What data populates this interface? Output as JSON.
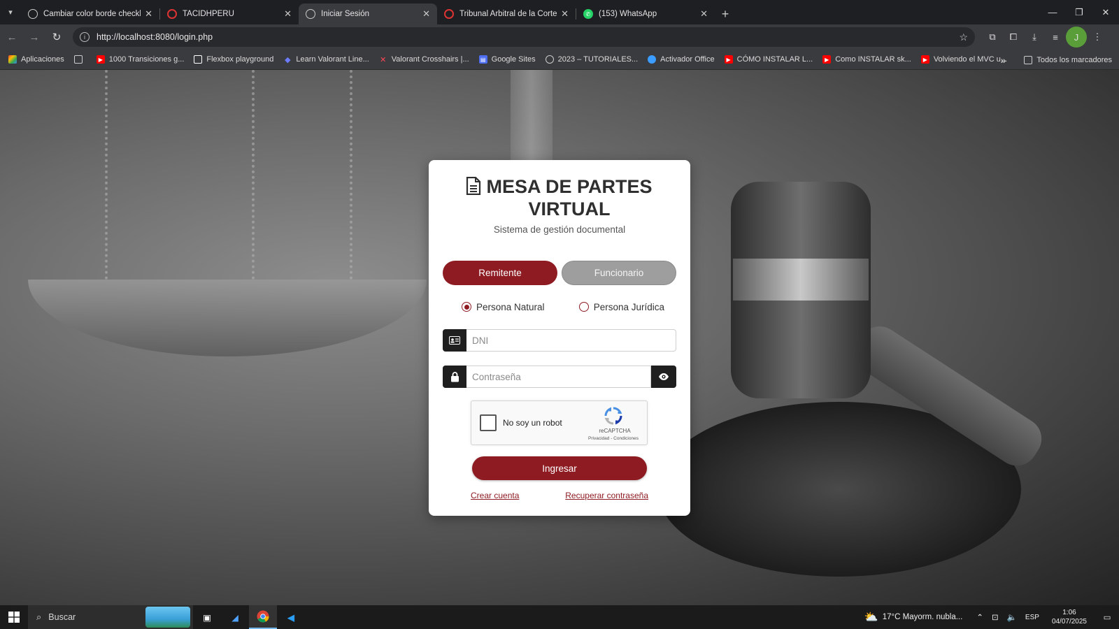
{
  "browser": {
    "tabs": [
      {
        "title": "Cambiar color borde checkbox",
        "favicon": "globe-icon",
        "active": false
      },
      {
        "title": "TACIDHPERU",
        "favicon": "red-circle-icon",
        "active": false
      },
      {
        "title": "Iniciar Sesión",
        "favicon": "globe-icon",
        "active": true
      },
      {
        "title": "Tribunal Arbitral de la Corte Inte",
        "favicon": "red-circle-icon",
        "active": false
      },
      {
        "title": "(153) WhatsApp",
        "favicon": "whatsapp-icon",
        "active": false
      }
    ],
    "url": "http://localhost:8080/login.php",
    "bookmarks": [
      {
        "label": "Aplicaciones",
        "icon": "apps-grid-icon",
        "color": "#e8a33d"
      },
      {
        "label": "",
        "icon": "grid-icon",
        "color": "#cccccc"
      },
      {
        "label": "1000 Transiciones g...",
        "icon": "youtube-icon",
        "color": "#ff0000"
      },
      {
        "label": "Flexbox playground",
        "icon": "flexbox-icon",
        "color": "#ffffff"
      },
      {
        "label": "Learn Valorant Line...",
        "icon": "diamond-icon",
        "color": "#6d7cff"
      },
      {
        "label": "Valorant Crosshairs |...",
        "icon": "valorant-icon",
        "color": "#ff4655"
      },
      {
        "label": "Google Sites",
        "icon": "sites-icon",
        "color": "#4e6ef2"
      },
      {
        "label": "2023 – TUTORIALES...",
        "icon": "globe-icon",
        "color": "#cccccc"
      },
      {
        "label": "Activador Office",
        "icon": "cloud-icon",
        "color": "#3b9dff"
      },
      {
        "label": "CÓMO INSTALAR L...",
        "icon": "youtube-icon",
        "color": "#ff0000"
      },
      {
        "label": "Como INSTALAR sk...",
        "icon": "youtube-icon",
        "color": "#ff0000"
      },
      {
        "label": "Volviendo el MVC u...",
        "icon": "youtube-icon",
        "color": "#ff0000"
      }
    ],
    "bookmarks_more": "»",
    "all_bookmarks_label": "Todos los marcadores",
    "profile_initial": "J"
  },
  "login": {
    "title": "MESA DE PARTES VIRTUAL",
    "subtitle": "Sistema de gestión documental",
    "role_tabs": [
      "Remitente",
      "Funcionario"
    ],
    "active_role": "Remitente",
    "person_types": [
      "Persona Natural",
      "Persona Jurídica"
    ],
    "selected_person_type": "Persona Natural",
    "dni_placeholder": "DNI",
    "password_placeholder": "Contraseña",
    "captcha_label": "No soy un robot",
    "captcha_brand": "reCAPTCHA",
    "captcha_terms": "Privacidad - Condiciones",
    "submit_label": "Ingresar",
    "create_account_label": "Crear cuenta",
    "recover_password_label": "Recuperar contraseña",
    "accent_color": "#8e1b22"
  },
  "taskbar": {
    "search_placeholder": "Buscar",
    "weather": "17°C  Mayorm. nubla...",
    "language": "ESP",
    "time": "1:06",
    "date": "04/07/2025"
  }
}
